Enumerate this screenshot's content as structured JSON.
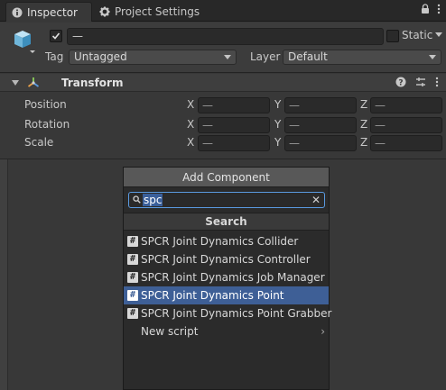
{
  "tabs": [
    {
      "label": "Inspector",
      "icon": "info-icon",
      "active": true
    },
    {
      "label": "Project Settings",
      "icon": "gear-icon",
      "active": false
    }
  ],
  "header": {
    "name_value": "—",
    "static_label": "Static",
    "tag_label": "Tag",
    "tag_value": "Untagged",
    "layer_label": "Layer",
    "layer_value": "Default"
  },
  "transform": {
    "title": "Transform",
    "rows": [
      {
        "label": "Position",
        "x": "—",
        "y": "—",
        "z": "—"
      },
      {
        "label": "Rotation",
        "x": "—",
        "y": "—",
        "z": "—"
      },
      {
        "label": "Scale",
        "x": "—",
        "y": "—",
        "z": "—"
      }
    ],
    "axes": [
      "X",
      "Y",
      "Z"
    ]
  },
  "add_component": {
    "title": "Add Component",
    "search_value": "spc",
    "section_header": "Search",
    "items": [
      {
        "label": "SPCR Joint Dynamics Collider",
        "icon": "script-icon",
        "selected": false
      },
      {
        "label": "SPCR Joint Dynamics Controller",
        "icon": "script-icon",
        "selected": false
      },
      {
        "label": "SPCR Joint Dynamics Job Manager",
        "icon": "script-icon",
        "selected": false
      },
      {
        "label": "SPCR Joint Dynamics Point",
        "icon": "script-icon",
        "selected": true
      },
      {
        "label": "SPCR Joint Dynamics Point Grabber",
        "icon": "script-icon",
        "selected": false
      }
    ],
    "new_script_label": "New script"
  },
  "colors": {
    "background": "#383838",
    "selection": "#3e5f96",
    "focus_border": "#5a9ae0"
  }
}
